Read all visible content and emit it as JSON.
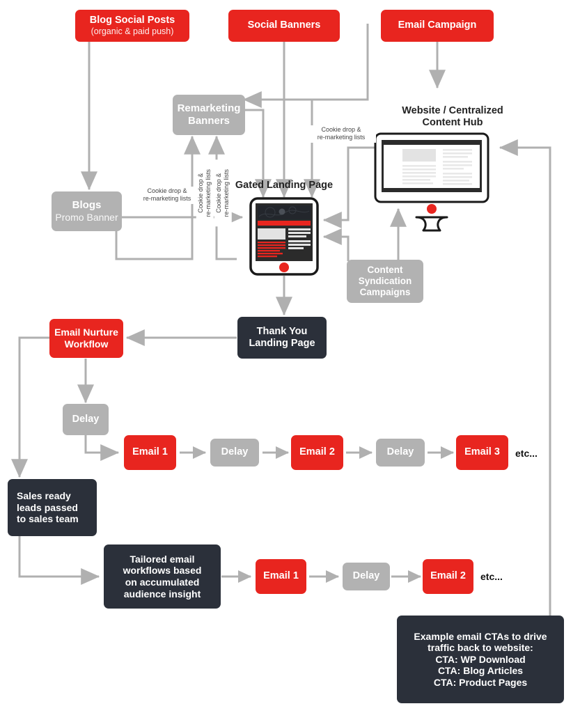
{
  "meta": {
    "title": "Content Marketing Demand Generation Flow Diagram",
    "colors": {
      "red": "#e8251f",
      "gray": "#b2b2b2",
      "dark": "#2b303a",
      "arrow": "#b0b0b0",
      "text_dark": "#222222",
      "background": "#ffffff"
    }
  },
  "nodes": {
    "blog_social_posts": {
      "line1": "Blog Social Posts",
      "line2": "(organic & paid push)"
    },
    "social_banners": {
      "line1": "Social Banners"
    },
    "email_campaign": {
      "line1": "Email Campaign"
    },
    "remarketing_banners": {
      "line1": "Remarketing",
      "line2": "Banners"
    },
    "blogs": {
      "line1": "Blogs",
      "line2": "Promo Banner"
    },
    "content_syndication": {
      "line1": "Content",
      "line2": "Syndication",
      "line3": "Campaigns"
    },
    "thank_you": {
      "line1": "Thank You",
      "line2": "Landing Page"
    },
    "email_nurture": {
      "line1": "Email Nurture",
      "line2": "Workflow"
    },
    "delay_top": {
      "line1": "Delay"
    },
    "sales_ready": {
      "line1": "Sales ready",
      "line2": "leads passed",
      "line3": "to sales team"
    },
    "tailored": {
      "line1": "Tailored email",
      "line2": "workflows based",
      "line3": "on accumulated",
      "line4": "audience insight"
    },
    "cta_box": {
      "line1": "Example email CTAs to drive",
      "line2": "traffic back to website:",
      "line3": "CTA: WP Download",
      "line4": "CTA: Blog Articles",
      "line5": "CTA: Product Pages"
    }
  },
  "section_labels": {
    "website_hub_line1": "Website / Centralized",
    "website_hub_line2": "Content Hub",
    "gated_landing_page": "Gated Landing Page"
  },
  "edge_labels": {
    "cookie_blogs_line1": "Cookie drop &",
    "cookie_blogs_line2": "re-marketing lists",
    "cookie_rot1_line1": "Cookie drop &",
    "cookie_rot1_line2": "re-marketing lists",
    "cookie_rot2_line1": "Cookie drop &",
    "cookie_rot2_line2": "re-marketing lists",
    "cookie_hub_line1": "Cookie drop &",
    "cookie_hub_line2": "re-marketing lists"
  },
  "nurture_row_1": {
    "items": [
      {
        "label": "Email 1",
        "type": "red"
      },
      {
        "label": "Delay",
        "type": "gray"
      },
      {
        "label": "Email 2",
        "type": "red"
      },
      {
        "label": "Delay",
        "type": "gray"
      },
      {
        "label": "Email 3",
        "type": "red"
      }
    ],
    "etc": "etc..."
  },
  "nurture_row_2": {
    "items": [
      {
        "label": "Email 1",
        "type": "red"
      },
      {
        "label": "Delay",
        "type": "gray"
      },
      {
        "label": "Email 2",
        "type": "red"
      }
    ],
    "etc": "etc..."
  }
}
